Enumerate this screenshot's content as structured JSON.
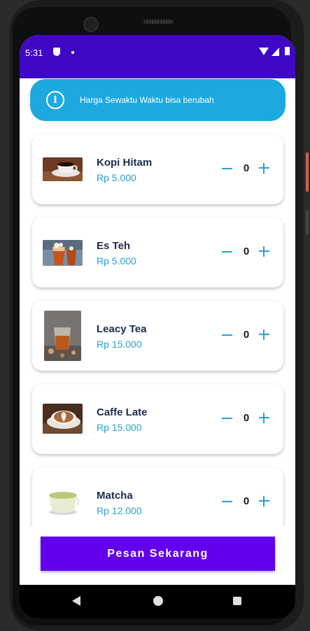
{
  "status_bar": {
    "time": "5:31"
  },
  "banner": {
    "text": "Harga Sewaktu Waktu bisa berubah",
    "icon": "info-icon"
  },
  "menu": [
    {
      "name": "Kopi Hitam",
      "price": "Rp 5.000",
      "qty": "0"
    },
    {
      "name": "Es Teh",
      "price": "Rp 5.000",
      "qty": "0"
    },
    {
      "name": "Leacy Tea",
      "price": "Rp 15.000",
      "qty": "0"
    },
    {
      "name": "Caffe Late",
      "price": "Rp 15.000",
      "qty": "0"
    },
    {
      "name": "Matcha",
      "price": "Rp 12.000",
      "qty": "0"
    }
  ],
  "order_button": "Pesan Sekarang",
  "colors": {
    "status_bar": "#3f08c5",
    "banner": "#1ea8e0",
    "accent": "#2a9fd6",
    "button": "#6200ee"
  }
}
